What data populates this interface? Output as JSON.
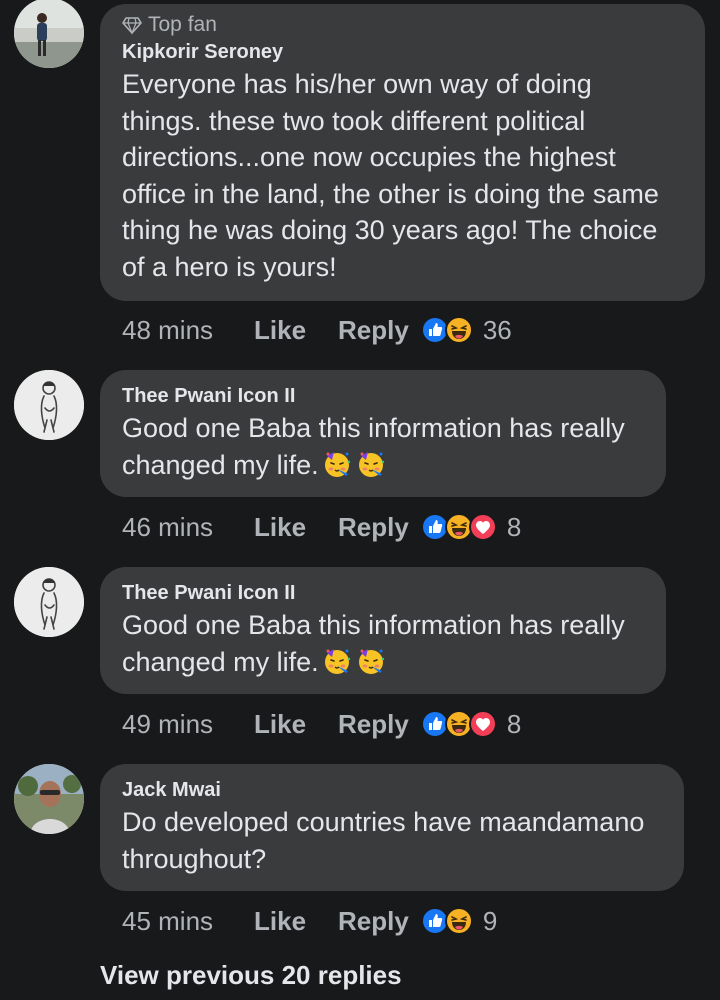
{
  "comments": [
    {
      "badge": "Top fan",
      "author": "Kipkorir Seroney",
      "lines": [
        "Everyone has his/her own way of doing",
        "things. these two took different political",
        "directions...one now occupies the highest",
        "office in the land, the other is doing the same",
        "thing he was doing 30 years ago! The choice",
        "of a hero is yours!"
      ],
      "time": "48 mins",
      "like": "Like",
      "reply": "Reply",
      "reactions": [
        "like-reaction-icon",
        "haha-reaction-icon"
      ],
      "count": "36"
    },
    {
      "author": "Thee Pwani Icon II",
      "lines": [
        "Good one Baba this information has really",
        "changed my life."
      ],
      "emojis": [
        "party-face-emoji",
        "party-face-emoji"
      ],
      "time": "46 mins",
      "like": "Like",
      "reply": "Reply",
      "reactions": [
        "like-reaction-icon",
        "haha-reaction-icon",
        "love-reaction-icon"
      ],
      "count": "8"
    },
    {
      "author": "Thee Pwani Icon II",
      "lines": [
        "Good one Baba this information has really",
        "changed my life."
      ],
      "emojis": [
        "party-face-emoji",
        "party-face-emoji"
      ],
      "time": "49 mins",
      "like": "Like",
      "reply": "Reply",
      "reactions": [
        "like-reaction-icon",
        "haha-reaction-icon",
        "love-reaction-icon"
      ],
      "count": "8"
    },
    {
      "author": "Jack Mwai",
      "lines": [
        "Do developed countries have maandamano",
        "throughout?"
      ],
      "time": "45 mins",
      "like": "Like",
      "reply": "Reply",
      "reactions": [
        "like-reaction-icon",
        "haha-reaction-icon"
      ],
      "count": "9"
    }
  ],
  "footer": {
    "view_previous": "View previous 20 replies"
  },
  "colors": {
    "background": "#18191a",
    "bubble": "#3a3b3c",
    "primary_text": "#e4e6eb",
    "secondary_text": "#b0b3b8",
    "like_blue": "#1877f2",
    "love_red": "#f33e58",
    "haha_yellow": "#f7b125"
  }
}
